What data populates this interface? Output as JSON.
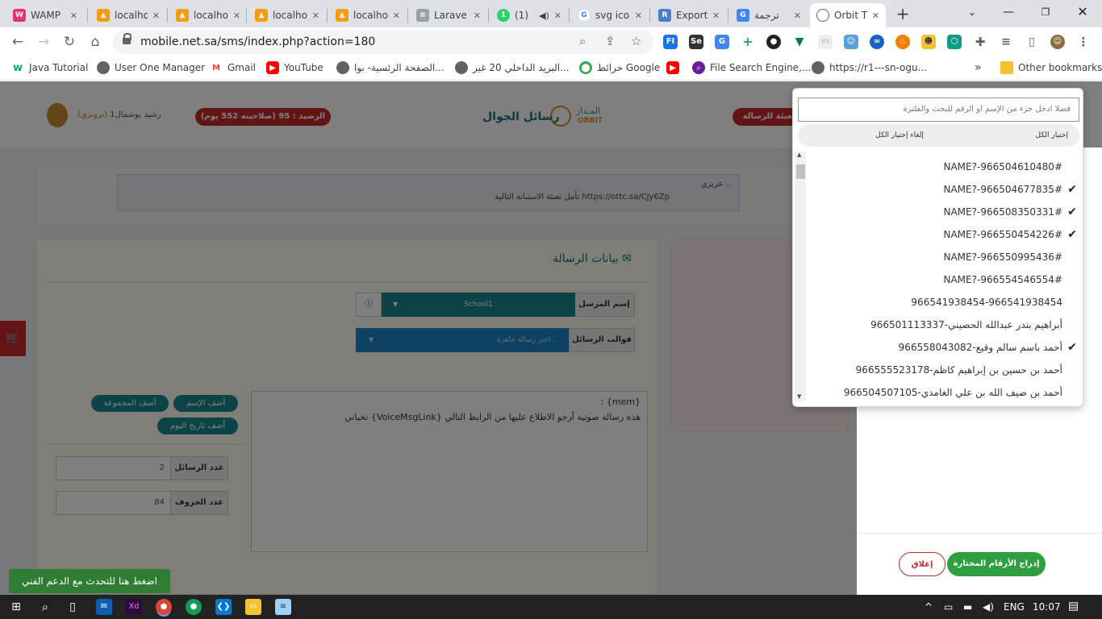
{
  "browser": {
    "tabs": [
      {
        "title": "WAMP",
        "icon": "wamp-icon",
        "color": "#e8336d"
      },
      {
        "title": "localho",
        "icon": "pma-icon",
        "color": "#f89c0e"
      },
      {
        "title": "localho",
        "icon": "pma-icon",
        "color": "#f89c0e"
      },
      {
        "title": "localho",
        "icon": "pma-icon",
        "color": "#f89c0e"
      },
      {
        "title": "localho",
        "icon": "pma-icon",
        "color": "#f89c0e"
      },
      {
        "title": "Larave",
        "icon": "doc-icon",
        "color": "#9aa0a6"
      },
      {
        "title": "(1)",
        "icon": "whatsapp-icon",
        "color": "#25d366"
      },
      {
        "title": "svg ico",
        "icon": "google-icon",
        "color": "#4285f4"
      },
      {
        "title": "Export",
        "icon": "repo-icon",
        "color": "#4a7ec9"
      },
      {
        "title": "ترجمة",
        "icon": "translate-icon",
        "color": "#4285f4"
      },
      {
        "title": "Orbit T",
        "icon": "globe-icon",
        "color": "#5f6368"
      }
    ],
    "url": "mobile.net.sa/sms/index.php?action=180",
    "bookmarks": [
      {
        "label": "Java Tutorial",
        "icon": "w3-icon"
      },
      {
        "label": "User One Manager",
        "icon": "globe-icon"
      },
      {
        "label": "Gmail",
        "icon": "gmail-icon"
      },
      {
        "label": "YouTube",
        "icon": "youtube-icon"
      },
      {
        "label": "الصفحة الرئسية- بوا...",
        "icon": "globe-icon"
      },
      {
        "label": "البريد الداخلي 20 غير...",
        "icon": "globe-icon"
      },
      {
        "label": "خرائط Google",
        "icon": "maps-icon"
      },
      {
        "label": "",
        "icon": "youtube-icon"
      },
      {
        "label": "File Search Engine,...",
        "icon": "search-engine-icon"
      },
      {
        "label": "https://r1---sn-ogu...",
        "icon": "globe-icon"
      }
    ],
    "bookmarks_more": "»",
    "other_bookmarks": "Other bookmarks"
  },
  "site": {
    "user_name": "رشيد بوشمال1",
    "user_rank": "(برونزي)",
    "balance": "الرصيد : 95 (صلاحيته 552 يوم)",
    "logo_top": "المـدار",
    "logo_sub": "ORBIT",
    "logo_title": "رسائل الجوال",
    "header_button": "تعبئة للرسالة",
    "notice_line1": "عزيزي ..",
    "notice_line2": "تأمل تعبئة الاستبانة التالية https://ottc.sa/CJy6Zp",
    "section_title": "بيانات الرسالة",
    "sender_label": "إسم المرسل",
    "sender_value": "School1",
    "templates_label": "قوالب الرسائل",
    "templates_placeholder": "اختر رسالة جاهزة...",
    "add_name": "أضف الإسم",
    "add_group": "أضف المجموعة",
    "add_date": "أضف تاريخ اليوم",
    "msg_count_label": "عدد الرسائل",
    "msg_count": "2",
    "char_count_label": "عدد الحروف",
    "char_count": "84",
    "message_line1": "{mem} :",
    "message_line2": "هذه رسالة صوتية أرجو الاطلاع عليها من الرابط التالي {VoiceMsgLink}  تحياتي",
    "support": "اضغط هنا للتحدث مع الدعم الفني"
  },
  "modal": {
    "insert_button": "إدراج الأرقام المختارة",
    "close_button": "إغلاق"
  },
  "dropdown": {
    "search_placeholder": "فضلا ادخل جزء من الإسم او الرقم للبحث والفلترة",
    "select_all": "إختيار الكل",
    "deselect_all": "إلغاء إختيار الكل",
    "items": [
      {
        "label": "NAME?-966504610480#",
        "checked": false
      },
      {
        "label": "NAME?-966504677835#",
        "checked": true
      },
      {
        "label": "NAME?-966508350331#",
        "checked": true
      },
      {
        "label": "NAME?-966550454226#",
        "checked": true
      },
      {
        "label": "NAME?-966550995436#",
        "checked": false
      },
      {
        "label": "NAME?-966554546554#",
        "checked": false
      },
      {
        "label": "966541938454-966541938454",
        "checked": false
      },
      {
        "label": "أبراهيم بندر عبدالله الحصيني-966501113337",
        "checked": false
      },
      {
        "label": "أحمد باسم سالم وقيع-966558043082",
        "checked": true
      },
      {
        "label": "أحمد بن حسين بن إبراهيم كاظم-966555523178",
        "checked": false
      },
      {
        "label": "أحمد بن ضيف الله بن علي الغامدي-966504507105",
        "checked": false
      }
    ]
  },
  "taskbar": {
    "lang": "ENG",
    "time": "10:07"
  },
  "colors": {
    "teal": "#17868f",
    "red": "#c62a2a",
    "green": "#2e9e3e"
  }
}
